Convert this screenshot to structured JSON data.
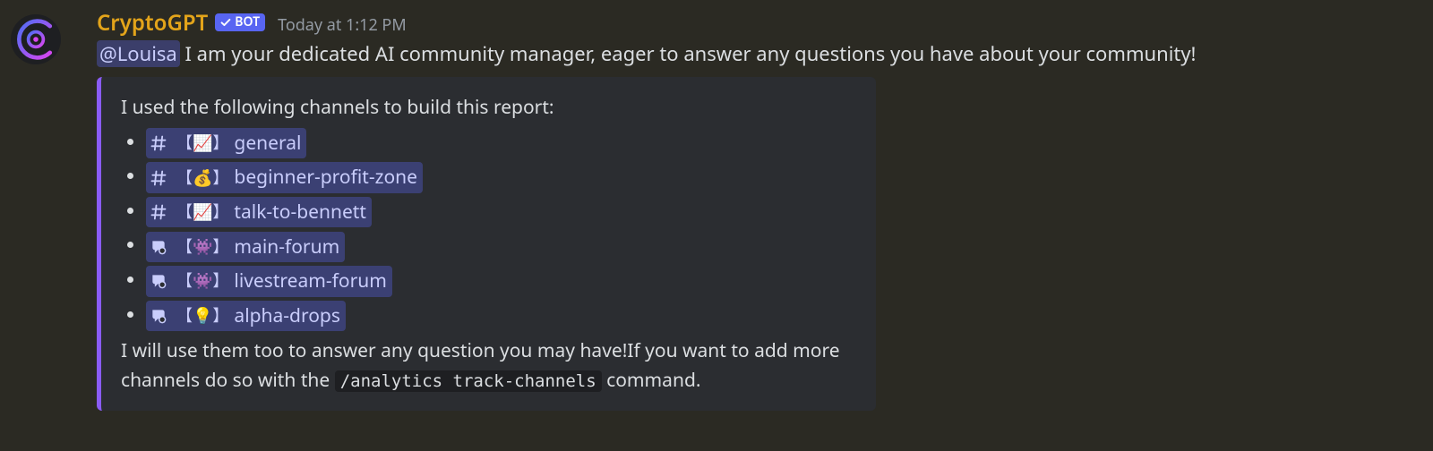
{
  "message": {
    "username": "CryptoGPT",
    "bot_tag": "BOT",
    "timestamp": "Today at 1:12 PM",
    "mention": "@Louisa",
    "body_after_mention": " I am your dedicated AI community manager, eager to answer any questions you have about your community!"
  },
  "embed": {
    "intro": "I used the following channels to build this report:",
    "channels": [
      {
        "icon_type": "hash",
        "emoji": "📈",
        "name": "general"
      },
      {
        "icon_type": "hash",
        "emoji": "💰",
        "name": "beginner-profit-zone"
      },
      {
        "icon_type": "hash",
        "emoji": "📈",
        "name": "talk-to-bennett"
      },
      {
        "icon_type": "forum",
        "emoji": "👾",
        "name": "main-forum"
      },
      {
        "icon_type": "forum",
        "emoji": "👾",
        "name": "livestream-forum"
      },
      {
        "icon_type": "forum",
        "emoji": "💡",
        "name": "alpha-drops"
      }
    ],
    "outro_before_code": "I will use them too to answer any question you may have!If you want to add more channels do so with the ",
    "code": "/analytics track-channels",
    "outro_after_code": " command."
  }
}
